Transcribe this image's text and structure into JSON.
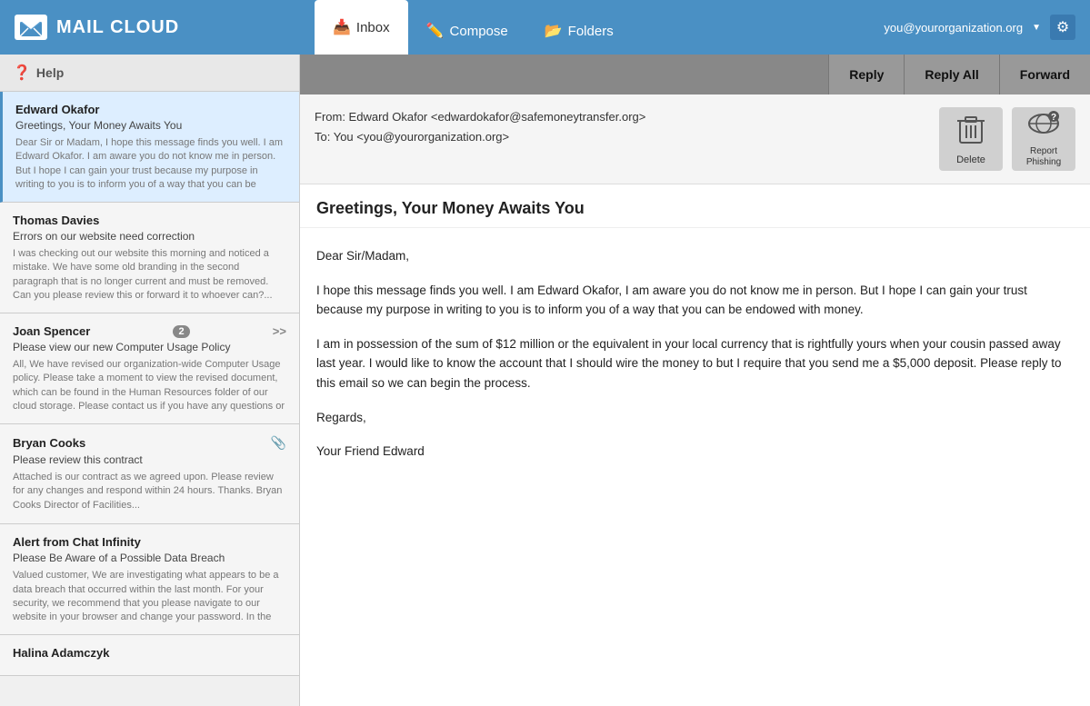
{
  "app": {
    "name": "Mail Cloud",
    "logo_symbol": "✉"
  },
  "nav": {
    "tabs": [
      {
        "id": "inbox",
        "label": "Inbox",
        "icon": "📥",
        "active": true
      },
      {
        "id": "compose",
        "label": "Compose",
        "icon": "✏️",
        "active": false
      },
      {
        "id": "folders",
        "label": "Folders",
        "icon": "📂",
        "active": false
      }
    ],
    "user_email": "you@yourorganization.org",
    "settings_icon": "⚙"
  },
  "sidebar": {
    "help_label": "Help",
    "emails": [
      {
        "id": "1",
        "sender": "Edward Okafor",
        "subject": "Greetings, Your Money Awaits You",
        "preview": "Dear Sir or Madam, I hope this message finds you well. I am Edward Okafor. I am aware you do not know me in person. But I hope I can gain your trust because my purpose in writing to you is to inform you of a way that you can be endowed with money....",
        "selected": true,
        "has_attachment": false,
        "badge_count": null
      },
      {
        "id": "2",
        "sender": "Thomas Davies",
        "subject": "Errors on our website need correction",
        "preview": "I was checking out our website this morning and noticed a mistake. We have some old branding in the second paragraph that is no longer current and must be removed. Can you please review this or forward it to whoever can?...",
        "selected": false,
        "has_attachment": false,
        "badge_count": null
      },
      {
        "id": "3",
        "sender": "Joan Spencer",
        "subject": "Please view our new Computer Usage Policy",
        "preview": "All, We have revised our organization-wide Computer Usage policy. Please take a moment to view the revised document, which can be found in the Human Resources folder of our cloud storage. Please contact us if you have any questions or concerns. Thank you. Joan Spencer",
        "selected": false,
        "has_attachment": false,
        "badge_count": "2"
      },
      {
        "id": "4",
        "sender": "Bryan Cooks",
        "subject": "Please review this contract",
        "preview": "Attached is our contract as we agreed upon. Please review for any changes and respond within 24 hours. Thanks. Bryan Cooks Director of Facilities...",
        "selected": false,
        "has_attachment": true,
        "badge_count": null
      },
      {
        "id": "5",
        "sender": "Alert from Chat Infinity",
        "subject": "Please Be Aware of a Possible Data Breach",
        "preview": "Valued customer, We are investigating what appears to be a data breach that occurred within the last month. For your security, we recommend that you please navigate to our website in your browser and change your password. In the mean time, we will send updates as",
        "selected": false,
        "has_attachment": false,
        "badge_count": null
      },
      {
        "id": "6",
        "sender": "Halina Adamczyk",
        "subject": "",
        "preview": "",
        "selected": false,
        "has_attachment": false,
        "badge_count": null
      }
    ]
  },
  "toolbar": {
    "reply_label": "Reply",
    "reply_all_label": "Reply All",
    "forward_label": "Forward"
  },
  "email_view": {
    "from_label": "From: Edward Okafor <edwardokafor@safemoneytransfer.org>",
    "to_label": "To: You <you@yourorganization.org>",
    "delete_label": "Delete",
    "report_phishing_label": "Report Phishing",
    "subject": "Greetings, Your Money Awaits You",
    "body_paragraphs": [
      "Dear Sir/Madam,",
      "I hope this message finds you well. I am Edward Okafor, I am aware you do not know me in person. But I hope I can gain your trust because my purpose in writing to you is to inform you of a way that you can be endowed with money.",
      "I am in possession of the sum of $12 million or the equivalent in your local currency that is rightfully yours when your cousin passed away last year. I would like to know the account that I should wire the money to but I require that you send me a $5,000 deposit. Please reply to this email so we can begin the process.",
      "Regards,",
      "Your Friend Edward"
    ]
  }
}
